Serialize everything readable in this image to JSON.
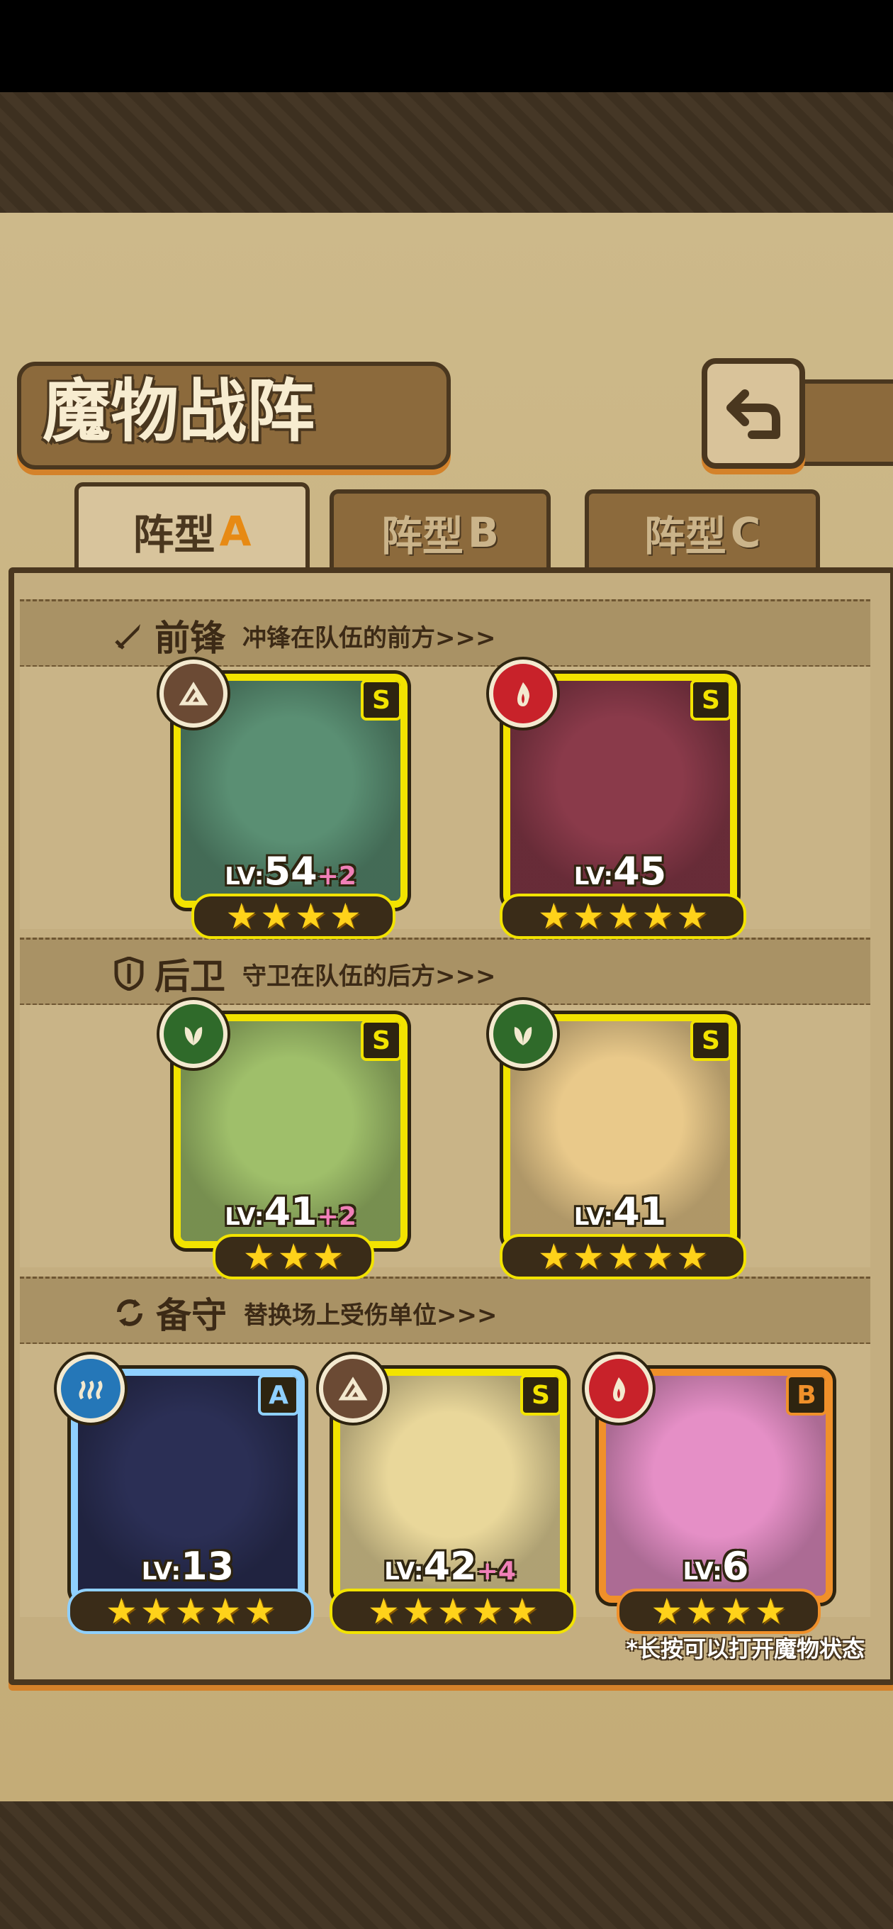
{
  "title": "魔物战阵",
  "tabs": [
    {
      "label": "阵型",
      "letter": "A",
      "active": true
    },
    {
      "label": "阵型",
      "letter": "B",
      "active": false
    },
    {
      "label": "阵型",
      "letter": "C",
      "active": false
    }
  ],
  "sections": {
    "front": {
      "name": "前锋",
      "desc": "冲锋在队伍的前方>>>",
      "icon": "sword-icon"
    },
    "back": {
      "name": "后卫",
      "desc": "守卫在队伍的后方>>>",
      "icon": "shield-icon"
    },
    "reserve": {
      "name": "备守",
      "desc": "替换场上受伤单位>>>",
      "icon": "swap-icon"
    }
  },
  "front_cards": [
    {
      "lv": "LV:",
      "lvnum": "54",
      "plus": "+2",
      "stars": 4,
      "rarity": "S",
      "element": "earth",
      "color": "#5a8f73"
    },
    {
      "lv": "LV:",
      "lvnum": "45",
      "plus": "",
      "stars": 5,
      "rarity": "S",
      "element": "fire",
      "color": "#8a3a4a"
    }
  ],
  "back_cards": [
    {
      "lv": "LV:",
      "lvnum": "41",
      "plus": "+2",
      "stars": 3,
      "rarity": "S",
      "element": "nature",
      "color": "#9fbf6a"
    },
    {
      "lv": "LV:",
      "lvnum": "41",
      "plus": "",
      "stars": 5,
      "rarity": "S",
      "element": "nature",
      "color": "#e9c98a"
    }
  ],
  "reserve_cards": [
    {
      "lv": "LV:",
      "lvnum": "13",
      "plus": "",
      "stars": 5,
      "rarity": "A",
      "element": "water",
      "color": "#2b2f55"
    },
    {
      "lv": "LV:",
      "lvnum": "42",
      "plus": "+4",
      "stars": 5,
      "rarity": "S",
      "element": "earth",
      "color": "#e9d79a"
    },
    {
      "lv": "LV:",
      "lvnum": "6",
      "plus": "",
      "stars": 4,
      "rarity": "B",
      "element": "fire",
      "color": "#e58fc6"
    }
  ],
  "hint": "*长按可以打开魔物状态",
  "colors": {
    "accent": "#f2e300",
    "frame": "#4a371f",
    "orange": "#d4822a"
  }
}
